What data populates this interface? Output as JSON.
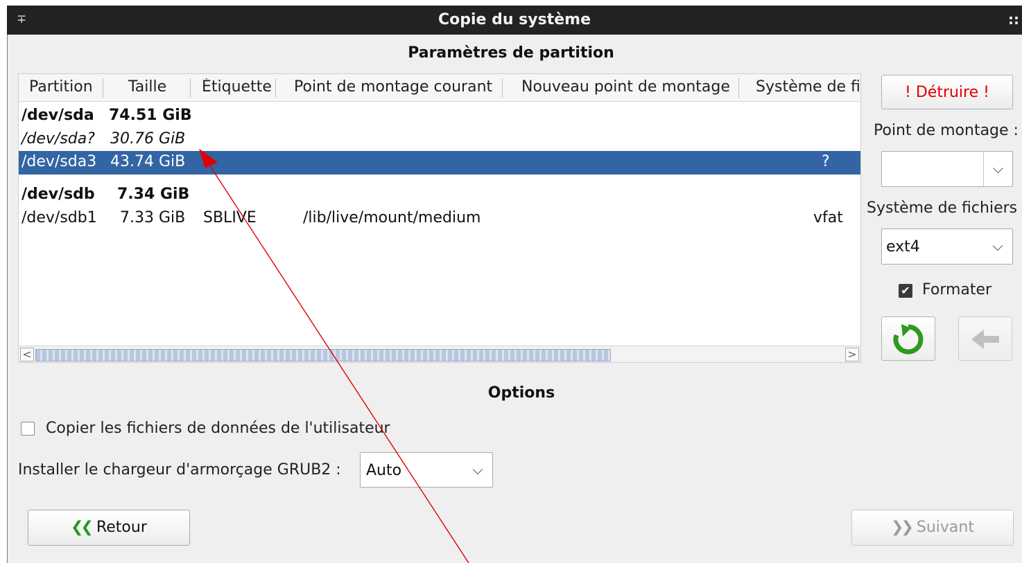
{
  "window": {
    "title": "Copie du système"
  },
  "partition_section": {
    "title": "Paramètres de partition"
  },
  "table": {
    "columns": [
      "Partition",
      "Taille",
      "Étiquette",
      "Point de montage courant",
      "Nouveau point de montage",
      "Système de fic"
    ],
    "rows": [
      {
        "partition": "/dev/sda",
        "size": "74.51 GiB",
        "label": "",
        "current_mount": "",
        "new_mount": "",
        "fs": "",
        "kind": "disk"
      },
      {
        "partition": "/dev/sda?",
        "size": "30.76 GiB",
        "label": "",
        "current_mount": "",
        "new_mount": "",
        "fs": "",
        "kind": "free"
      },
      {
        "partition": "/dev/sda3",
        "size": "43.74 GiB",
        "label": "",
        "current_mount": "",
        "new_mount": "",
        "fs": "?",
        "kind": "selected"
      },
      {
        "partition": "/dev/sdb",
        "size": "7.34 GiB",
        "label": "",
        "current_mount": "",
        "new_mount": "",
        "fs": "",
        "kind": "disk"
      },
      {
        "partition": "/dev/sdb1",
        "size": "7.33 GiB",
        "label": "SBLIVE",
        "current_mount": "/lib/live/mount/medium",
        "new_mount": "",
        "fs": "vfat",
        "kind": "normal"
      }
    ],
    "scroll_left": "<",
    "scroll_right": ">"
  },
  "side_panel": {
    "destroy_label": "! Détruire !",
    "mount_point_label": "Point de montage :",
    "mount_point_value": "",
    "filesystem_label": "Système de fichiers",
    "filesystem_value": "ext4",
    "format_label": "Formater",
    "format_checked": true,
    "undo_icon": "refresh-icon",
    "back_icon": "left-arrow-icon"
  },
  "options": {
    "title": "Options",
    "copy_user_data_label": "Copier les fichiers de données de l'utilisateur",
    "copy_user_data_checked": false,
    "grub_label": "Installer le chargeur d'armorçage GRUB2 :",
    "grub_value": "Auto"
  },
  "nav": {
    "back_label": "Retour",
    "next_label": "Suivant",
    "next_enabled": false
  },
  "colors": {
    "selection": "#3365a4",
    "destroy_text": "#e00000",
    "annotation": "#e00000",
    "undo_icon": "#2e9a1f"
  }
}
